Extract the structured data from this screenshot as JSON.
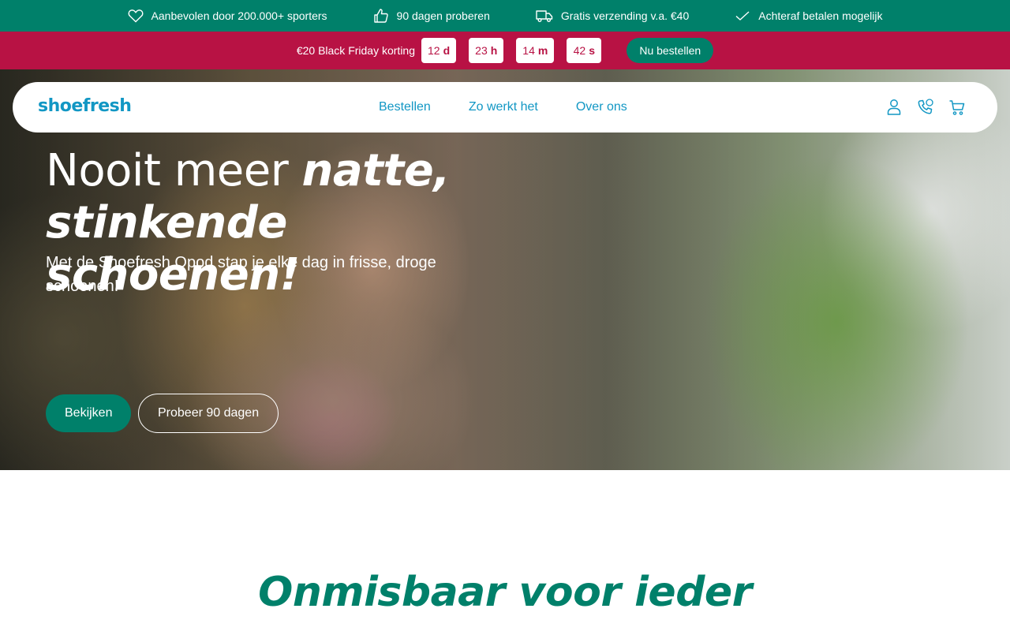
{
  "usp_bar": {
    "background": "#00806a",
    "items": [
      {
        "icon": "heart-icon",
        "label": "Aanbevolen door 200.000+ sporters"
      },
      {
        "icon": "thumbs-up-icon",
        "label": "90 dagen proberen"
      },
      {
        "icon": "truck-icon",
        "label": "Gratis verzending v.a. €40"
      },
      {
        "icon": "checkmark-icon",
        "label": "Achteraf betalen mogelijk"
      }
    ]
  },
  "promo_bar": {
    "background": "#b81244",
    "text": "€20 Black Friday korting",
    "countdown": [
      {
        "value": "12",
        "unit": "d"
      },
      {
        "value": "23",
        "unit": "h"
      },
      {
        "value": "14",
        "unit": "m"
      },
      {
        "value": "42",
        "unit": "s"
      }
    ],
    "button_label": "Nu bestellen"
  },
  "header": {
    "logo": "shoefresh",
    "nav": [
      "Bestellen",
      "Zo werkt het",
      "Over ons"
    ],
    "icons": [
      "user-icon",
      "phone-icon",
      "cart-icon"
    ],
    "accent": "#1297c4"
  },
  "hero": {
    "title_plain": "Nooit meer ",
    "title_emph_1": "natte,",
    "title_emph_2": "stinkende schoenen!",
    "subtitle": "Met de Shoefresh Opod stap je elke dag in frisse, droge schoenen!",
    "primary_button": "Bekijken",
    "secondary_button": "Probeer 90 dagen"
  },
  "section": {
    "heading": "Onmisbaar voor ieder",
    "color": "#00806a"
  }
}
